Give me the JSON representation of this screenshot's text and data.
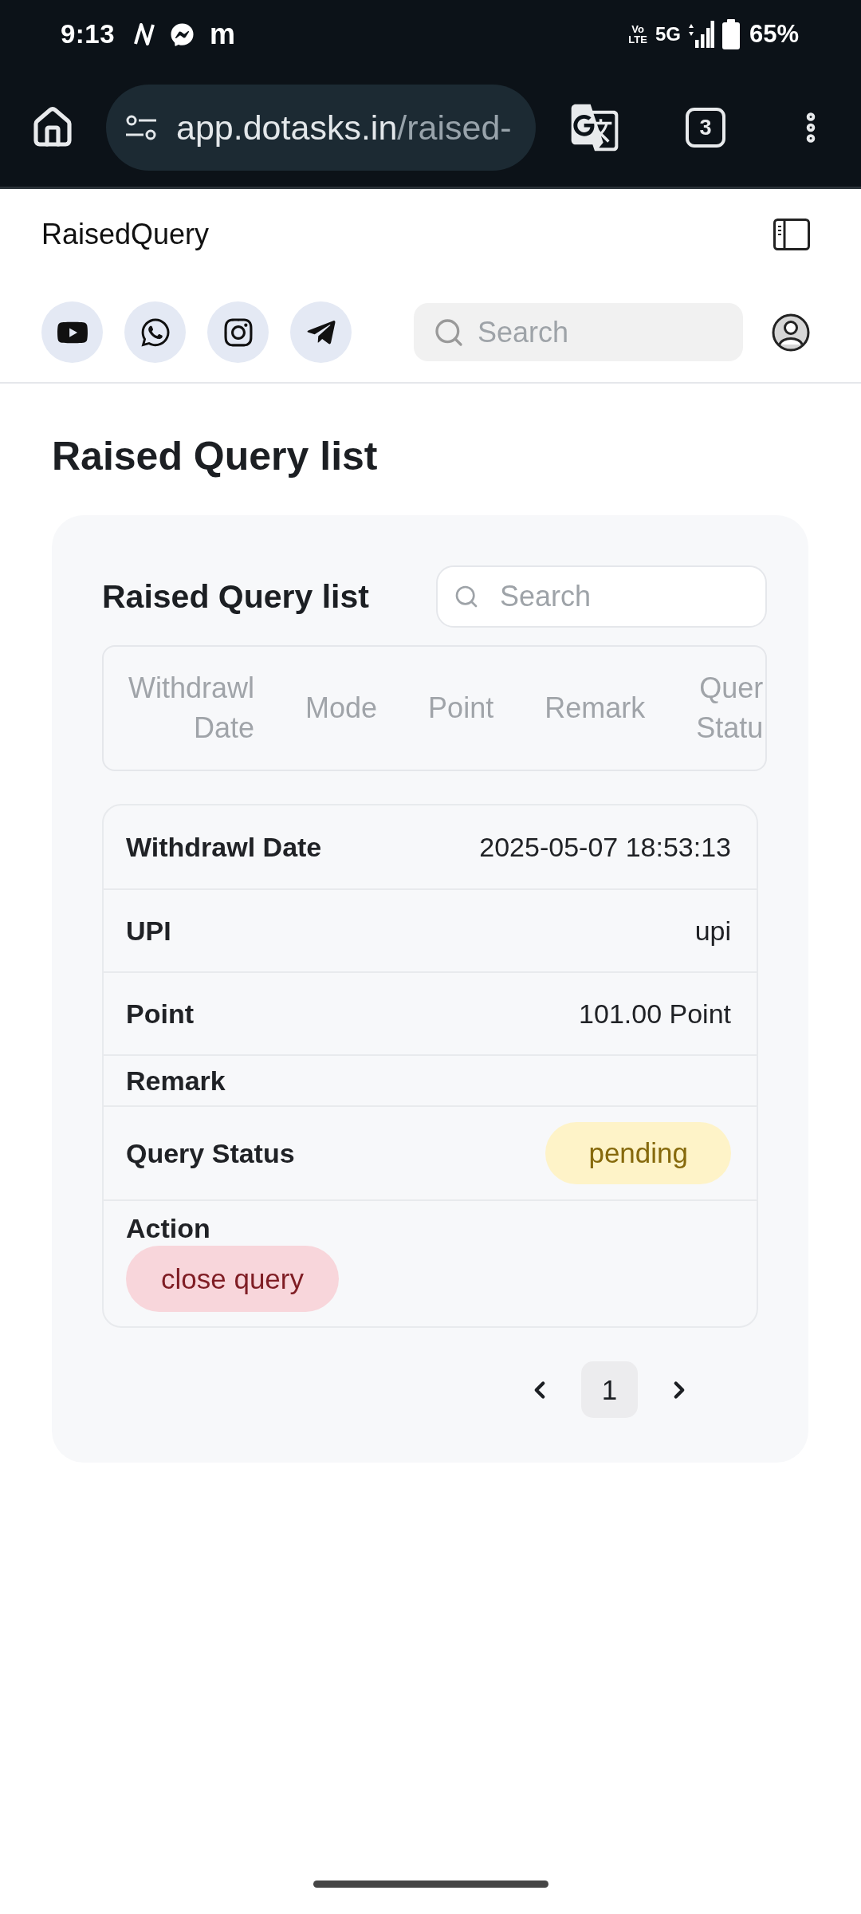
{
  "status_bar": {
    "time": "9:13",
    "notification_letter": "m",
    "volte": "Vo LTE",
    "network": "5G",
    "battery": "65%"
  },
  "browser": {
    "url_host": "app.dotasks.in",
    "url_path": "/raised-",
    "tab_count": "3"
  },
  "header": {
    "title": "RaisedQuery",
    "social_links": [
      {
        "kind": "youtube"
      },
      {
        "kind": "whatsapp"
      },
      {
        "kind": "instagram"
      },
      {
        "kind": "telegram"
      }
    ],
    "search": {
      "placeholder": "Search"
    }
  },
  "page_title": "Raised Query list",
  "card": {
    "title": "Raised Query list",
    "search": {
      "placeholder": "Search"
    },
    "table": {
      "columns": [
        "Withdrawl Date",
        "Mode",
        "Point",
        "Remark",
        "Quer Statu"
      ]
    },
    "record": {
      "fields": [
        {
          "kind": "text",
          "label": "Withdrawl Date",
          "value": "2025-05-07 18:53:13"
        },
        {
          "kind": "text",
          "label": "UPI",
          "value": "upi"
        },
        {
          "kind": "text",
          "label": "Point",
          "value": "101.00 Point"
        },
        {
          "kind": "empty",
          "label": "Remark"
        },
        {
          "kind": "status",
          "label": "Query Status",
          "value": "pending"
        },
        {
          "kind": "action",
          "label": "Action",
          "value": "close query"
        }
      ]
    },
    "pagination": {
      "pages": [
        {
          "label": "1",
          "selected": true
        }
      ]
    }
  }
}
